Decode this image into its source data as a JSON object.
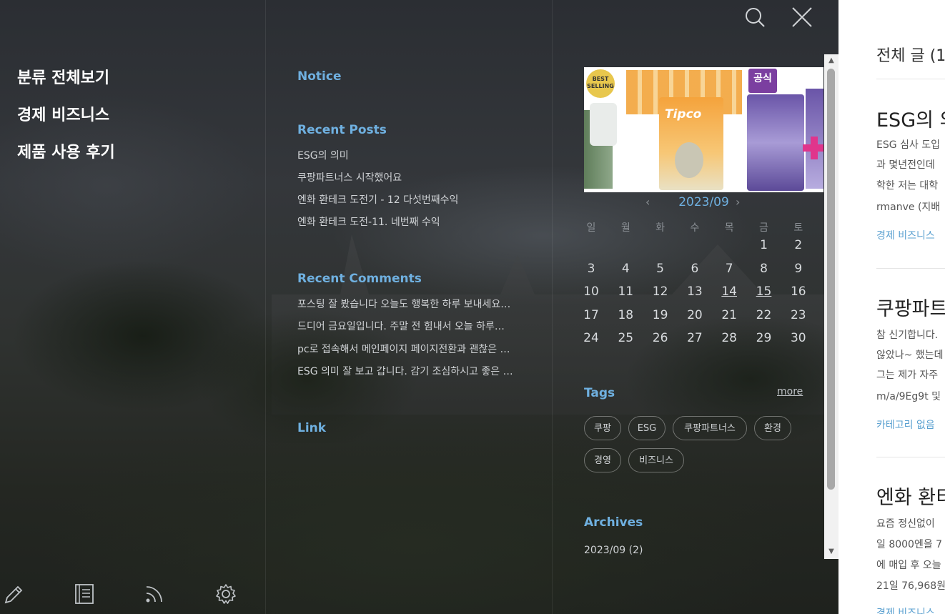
{
  "categories": [
    "분류 전체보기",
    "경제 비즈니스",
    "제품 사용 후기"
  ],
  "sections": {
    "notice": "Notice",
    "recent_posts": "Recent Posts",
    "recent_comments": "Recent Comments",
    "link": "Link",
    "tags": "Tags",
    "archives": "Archives",
    "more": "more"
  },
  "recent_posts": [
    "ESG의 의미",
    "쿠팡파트너스 시작했어요",
    "엔화 환테크 도전기 - 12 다섯번째수익",
    "엔화 환테크 도전-11. 네번째 수익"
  ],
  "recent_comments": [
    "포스팅 잘 봤습니다 오늘도 행복한 하루 보내세요…",
    "드디어 금요일입니다. 주말 전 힘내서 오늘 하루…",
    "pc로 접속해서 메인페이지 페이지전환과 괜찮은 …",
    "ESG 의미 잘 보고 갑니다. 감기 조심하시고 좋은 …"
  ],
  "banner": {
    "badge": "BEST\nSELLING",
    "juice": "Tipco",
    "official": "공식"
  },
  "calendar": {
    "title": "2023/09",
    "dow": [
      "일",
      "월",
      "화",
      "수",
      "목",
      "금",
      "토"
    ],
    "weeks": [
      [
        "",
        "",
        "",
        "",
        "",
        "1",
        "2"
      ],
      [
        "3",
        "4",
        "5",
        "6",
        "7",
        "8",
        "9"
      ],
      [
        "10",
        "11",
        "12",
        "13",
        "14",
        "15",
        "16"
      ],
      [
        "17",
        "18",
        "19",
        "20",
        "21",
        "22",
        "23"
      ],
      [
        "24",
        "25",
        "26",
        "27",
        "28",
        "29",
        "30"
      ]
    ],
    "linked_days": [
      "14",
      "15"
    ]
  },
  "tags": [
    "쿠팡",
    "ESG",
    "쿠팡파트너스",
    "환경",
    "경영",
    "비즈니스"
  ],
  "archives": [
    "2023/09 (2)"
  ],
  "content": {
    "heading": "전체 글 (1",
    "posts": [
      {
        "title": "ESG의 의",
        "lines": [
          "ESG 심사 도입",
          "과 몇년전인데",
          "학한 저는 대학",
          "rmanve (지배"
        ],
        "category": "경제 비즈니스"
      },
      {
        "title": "쿠팡파트",
        "lines": [
          "참 신기합니다.",
          "않았나~ 했는데",
          "그는 제가 자주",
          "m/a/9Eg9t 및"
        ],
        "category": "카테고리 없음"
      },
      {
        "title": "엔화 환티",
        "lines": [
          "요즘 정신없이",
          "일 8000엔을 7",
          "에 매입 후 오늘",
          "21일 76,968원"
        ],
        "category": "경제 비즈니스"
      }
    ]
  },
  "colors": {
    "accent": "#6fb0e0",
    "link": "#5aa0d0"
  }
}
